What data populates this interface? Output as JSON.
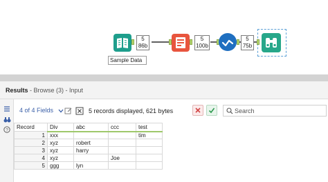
{
  "canvas": {
    "input_tool": {
      "caption": "Sample Data",
      "badge_count": "5",
      "badge_size": "86b"
    },
    "sample_tool": {
      "badge_count": "5",
      "badge_size": "100b"
    },
    "select_tool": {
      "badge_count": "5",
      "badge_size": "75b"
    }
  },
  "results": {
    "title": "Results",
    "subtitle": " - Browse (3) - Input",
    "fields_label": "4 of 4 Fields",
    "records_text": "5 records displayed, 621 bytes",
    "search_placeholder": "Search"
  },
  "grid": {
    "columns": [
      "Record",
      "Div",
      "abc",
      "ccc",
      "test"
    ],
    "rows": [
      [
        "1",
        "xxx",
        "",
        "",
        "tim"
      ],
      [
        "2",
        "xyz",
        "robert",
        "",
        ""
      ],
      [
        "3",
        "xyz",
        "harry",
        "",
        ""
      ],
      [
        "4",
        "xyz",
        "",
        "Joe",
        ""
      ],
      [
        "5",
        "ggg",
        "lyn",
        "",
        ""
      ]
    ]
  },
  "colors": {
    "accent": "#3a5fa8",
    "input_tool": "#1e9e8c",
    "sample_tool": "#e8553e",
    "select_tool": "#1f6fc0",
    "browse_tool": "#27a78a"
  }
}
